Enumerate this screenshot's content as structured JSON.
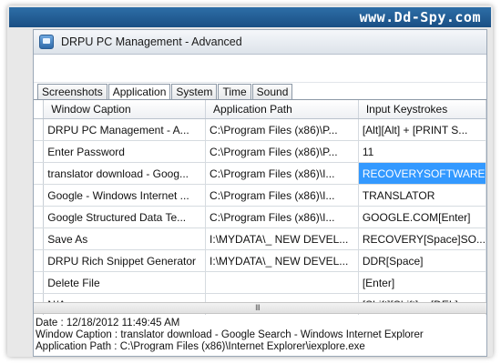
{
  "watermark": "www.Dd-Spy.com",
  "window": {
    "title": "DRPU PC Management - Advanced"
  },
  "tabs": [
    {
      "label": "Screenshots"
    },
    {
      "label": "Application"
    },
    {
      "label": "System"
    },
    {
      "label": "Time"
    },
    {
      "label": "Sound"
    }
  ],
  "grid": {
    "columns": [
      "Window Caption",
      "Application Path",
      "Input Keystrokes"
    ],
    "rows": [
      {
        "caption": "DRPU PC Management - A...",
        "path": "C:\\Program Files (x86)\\P...",
        "keys": "[Alt][Alt] + [PRINT S..."
      },
      {
        "caption": "Enter Password",
        "path": "C:\\Program Files (x86)\\P...",
        "keys": "11"
      },
      {
        "caption": "translator download - Goog...",
        "path": "C:\\Program Files (x86)\\I...",
        "keys": "RECOVERYSOFTWARE"
      },
      {
        "caption": "Google - Windows Internet ...",
        "path": "C:\\Program Files (x86)\\I...",
        "keys": "TRANSLATOR"
      },
      {
        "caption": "Google Structured Data Te...",
        "path": "C:\\Program Files (x86)\\I...",
        "keys": "GOOGLE.COM[Enter]"
      },
      {
        "caption": "Save As",
        "path": "I:\\MYDATA\\_ NEW DEVEL...",
        "keys": "RECOVERY[Space]SO..."
      },
      {
        "caption": "DRPU Rich Snippet Generator",
        "path": "I:\\MYDATA\\_ NEW DEVEL...",
        "keys": "DDR[Space]"
      },
      {
        "caption": "Delete File",
        "path": "",
        "keys": "[Enter]"
      },
      {
        "caption": "N/A",
        "path": "",
        "keys": "[Shift][Shift] + [DEL]"
      }
    ],
    "selected": {
      "row": 2,
      "column": "keys"
    }
  },
  "scrollbar": {
    "grip": "III"
  },
  "details": {
    "date": "Date : 12/18/2012 11:49:45 AM",
    "caption": "Window Caption : translator download - Google Search - Windows Internet Explorer",
    "path": "Application Path : C:\\Program Files (x86)\\Internet Explorer\\iexplore.exe"
  },
  "colors": {
    "selection": "#3399ff",
    "banner": "#1a4f84"
  }
}
